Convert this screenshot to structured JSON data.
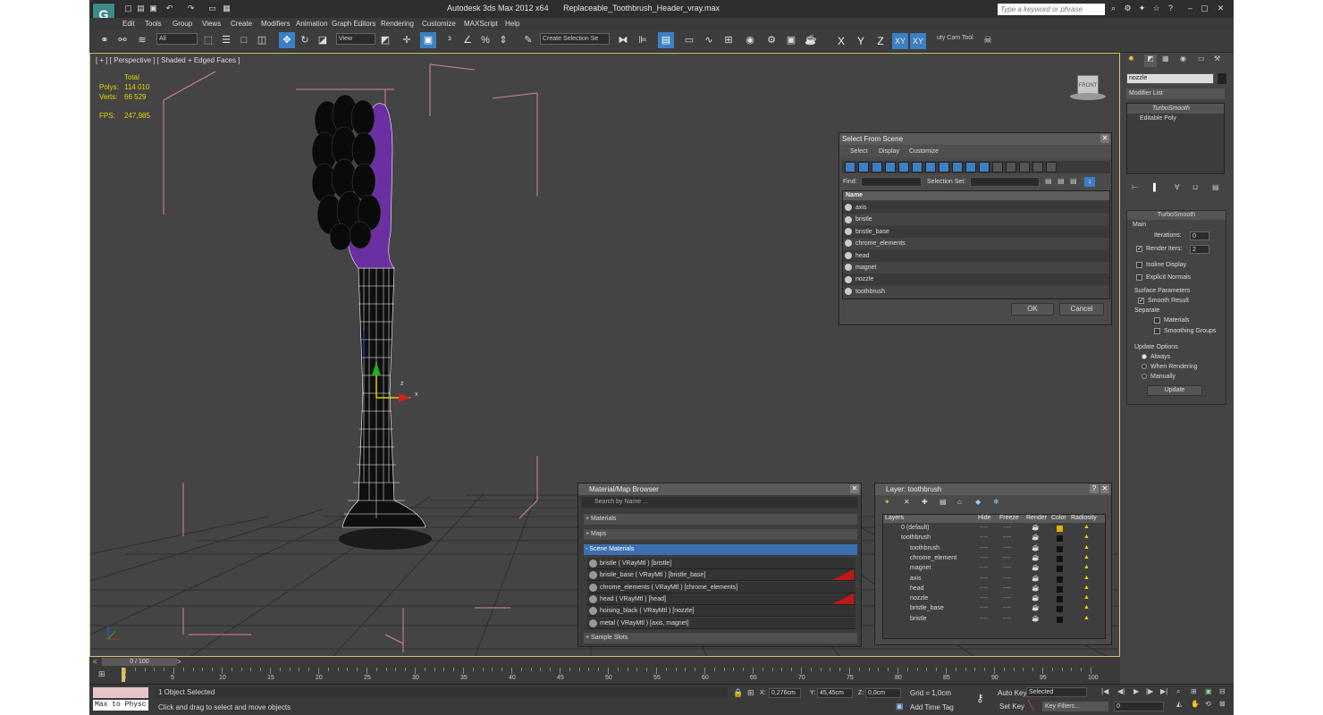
{
  "window": {
    "app_title": "Autodesk 3ds Max  2012 x64",
    "file_title": "Replaceable_Toothbrush_Header_vray.max",
    "search_placeholder": "Type a keyword or phrase",
    "logo": "3ds-max-logo-icon"
  },
  "menu": [
    "Edit",
    "Tools",
    "Group",
    "Views",
    "Create",
    "Modifiers",
    "Animation",
    "Graph Editors",
    "Rendering",
    "Customize",
    "MAXScript",
    "Help"
  ],
  "toolbar": {
    "filter_dropdown": "All",
    "refcoord_dropdown": "View",
    "selection_set": "Create Selection Se",
    "axes": [
      "X",
      "Y",
      "Z",
      "XY",
      "XY"
    ],
    "cam_tool": "uty Cam Tool"
  },
  "viewport": {
    "label": "[ + ] [ Perspective ] [ Shaded + Edged Faces ]",
    "stats": {
      "total_label": "Total",
      "polys_label": "Polys:",
      "polys": "114 010",
      "verts_label": "Verts:",
      "verts": "66 529",
      "fps_label": "FPS:",
      "fps": "247,985"
    },
    "viewcube_label": "FRONT",
    "gizmo_x": "x",
    "gizmo_z": "z",
    "colors": {
      "bg": "#444444",
      "grid": "#2a2a2a",
      "bbox": "#d7839a",
      "wire": "#ffffff",
      "head": "#6a2fa0"
    }
  },
  "select_from_scene": {
    "title": "Select From Scene",
    "menu": [
      "Select",
      "Display",
      "Customize"
    ],
    "find_label": "Find:",
    "selection_set_label": "Selection Set:",
    "column_name": "Name",
    "items": [
      "axis",
      "bristle",
      "bristle_base",
      "chrome_elements",
      "head",
      "magnet",
      "nozzle",
      "toothbrush"
    ],
    "ok": "OK",
    "cancel": "Cancel"
  },
  "material_browser": {
    "title": "Material/Map Browser",
    "search_placeholder": "Search by Name ...",
    "groups": [
      "+ Materials",
      "+ Maps",
      "- Scene Materials"
    ],
    "scene_materials": [
      "bristle  ( VRayMtl )  [bristle]",
      "bristle_base  ( VRayMtl )  [bristle_base]",
      "chrome_elements  ( VRayMtl )  [chrome_elements]",
      "head  ( VRayMtl )  [head]",
      "hoising_black  ( VRayMtl )  [nozzle]",
      "metal  ( VRayMtl )  [axis, magnet]"
    ],
    "sample_slots": "+ Sample Slots"
  },
  "layer_dialog": {
    "title": "Layer: toothbrush",
    "help": "?",
    "columns": [
      "Layers",
      "Hide",
      "Freeze",
      "Render",
      "Color",
      "Radiosity"
    ],
    "rows": [
      {
        "name": "0 (default)",
        "indent": 0
      },
      {
        "name": "toothbrush",
        "indent": 0
      },
      {
        "name": "toothbrush",
        "indent": 1
      },
      {
        "name": "chrome_element",
        "indent": 1
      },
      {
        "name": "magnet",
        "indent": 1
      },
      {
        "name": "axis",
        "indent": 1
      },
      {
        "name": "head",
        "indent": 1
      },
      {
        "name": "nozzle",
        "indent": 1
      },
      {
        "name": "bristle_base",
        "indent": 1
      },
      {
        "name": "bristle",
        "indent": 1
      }
    ],
    "dash": "----"
  },
  "command_panel": {
    "object_name": "nozzle",
    "modifier_list": "Modifier List",
    "stack": [
      "TurboSmooth",
      "Editable Poly"
    ],
    "rollout_title": "TurboSmooth",
    "main_label": "Main",
    "iterations_label": "Iterations:",
    "iterations": "0",
    "render_iters_label": "Render Iters:",
    "render_iters": "2",
    "isoline": "Isoline Display",
    "explicit": "Explicit Normals",
    "surface_params": "Surface Parameters",
    "smooth_result": "Smooth Result",
    "separate": "Separate",
    "materials": "Materials",
    "smoothing_groups": "Smoothing Groups",
    "update_options": "Update Options",
    "always": "Always",
    "when_rendering": "When Rendering",
    "manually": "Manually",
    "update_btn": "Update"
  },
  "timeline": {
    "frame": "0 / 100",
    "ticks": [
      "0",
      "5",
      "10",
      "15",
      "20",
      "25",
      "30",
      "35",
      "40",
      "45",
      "50",
      "55",
      "60",
      "65",
      "70",
      "75",
      "80",
      "85",
      "90",
      "95",
      "100"
    ]
  },
  "status": {
    "maxscript": "Max to Physc",
    "selected": "1 Object Selected",
    "prompt": "Click and drag to select and move objects",
    "x_label": "X:",
    "x": "0,276cm",
    "y_label": "Y:",
    "y": "45,45cm",
    "z_label": "Z:",
    "z": "0,0cm",
    "grid": "Grid = 1,0cm",
    "add_time_tag": "Add Time Tag",
    "auto_key": "Auto Key",
    "set_key": "Set Key",
    "selected_dropdown": "Selected",
    "key_filters": "Key Filters...",
    "frame_field": "0"
  }
}
